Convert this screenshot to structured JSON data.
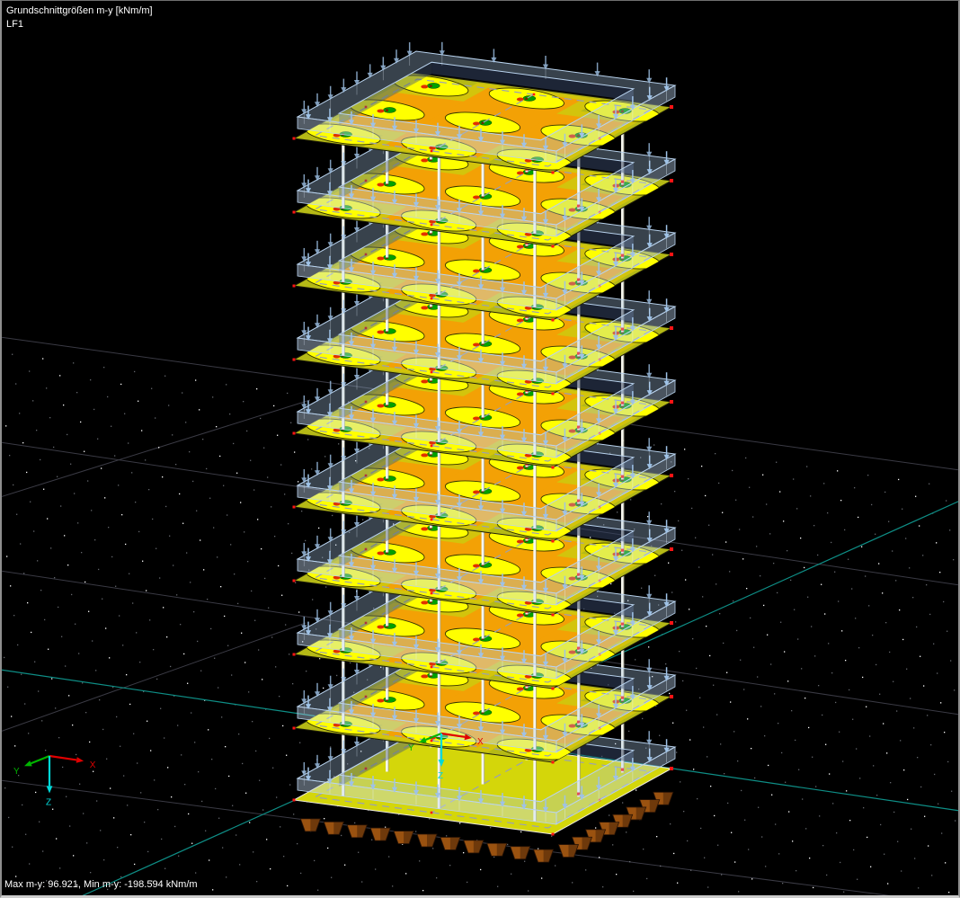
{
  "header": {
    "title": "Grundschnittgrößen m-y [kNm/m]",
    "load_case": "LF1"
  },
  "status_bar": {
    "summary": "Max m-y: 96.921, Min m-y: -198.594 kNm/m",
    "max_m_y": 96.921,
    "min_m_y": -198.594,
    "unit": "kNm/m"
  },
  "nav_axes": {
    "x": "X",
    "y": "Y",
    "z": "Z"
  },
  "origin_axes": {
    "x": "X",
    "y": "Y",
    "z": "Z"
  },
  "scene": {
    "floor_slabs": 9,
    "foundation_slab": 1,
    "wall_load_bands": 10,
    "columns_per_story": 9,
    "colors": {
      "background": "#000000",
      "slab_base": "#b5b916",
      "slab_mid": "#d3c40c",
      "slab_hot": "#f3a105",
      "peak_ellipse": "#ffff00",
      "peak_green": "#00a000",
      "peak_red": "#e03000",
      "peak_dark": "#6b2800",
      "foundation": "#d4d60a",
      "band_fill": "rgba(170,200,232,0.33)",
      "band_line": "#b9d3ee",
      "arrow": "#9fc2e6",
      "column": "#f7f7ee",
      "node": "#ff1414",
      "support": "#9a5210",
      "support_edge": "#2e1606",
      "grid_line": "#3a3a44",
      "axis_teal": "#0e8e86",
      "dot_bright": "#ffffff",
      "dot_dim": "#8f939b",
      "axis_x": "#e00000",
      "axis_y": "#00b400",
      "axis_z": "#00d8d8",
      "text": "#ffffff"
    }
  }
}
